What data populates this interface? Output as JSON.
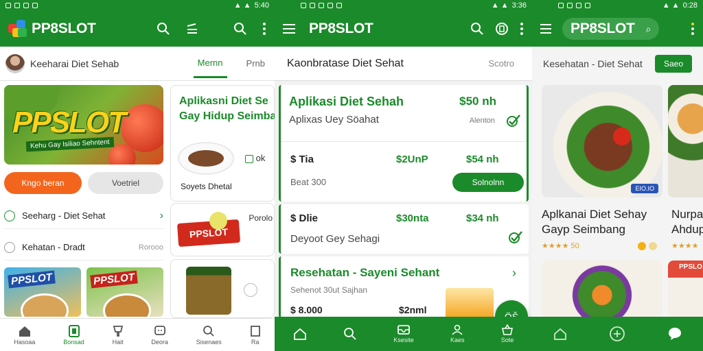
{
  "colors": {
    "brand_green": "#1b8a2a",
    "accent_orange": "#f3651d",
    "badge_blue": "#2a54b5"
  },
  "panel1": {
    "status_time": "5:40",
    "app_title": "PP8SLOT",
    "breadcrumb": "Keeharai Diet Sehab",
    "tabs": [
      "Mernn",
      "Prnb"
    ],
    "hero_brand": "PPSLOT",
    "hero_banner": "Kehu Gay Isiliao Sehntent",
    "btn_primary": "Kngo beran",
    "btn_secondary": "Voetriel",
    "list": [
      {
        "label": "Seeharg - Diet Sehat"
      },
      {
        "label": "Kehatan - Dradt",
        "meta": "Rorooo"
      }
    ],
    "mini_labels": [
      "PPSLOT",
      "PPSLOT"
    ],
    "card": {
      "title_line1": "Aplikasni Diet Se",
      "title_line2": "Gay Hidup Seimba",
      "side": "ok",
      "caption": "Soyets Dhetal"
    },
    "card2_badge": "PPSLOT",
    "card2_side": "Porolo",
    "bottom_nav": [
      "Hasoaa",
      "Bonsad",
      "Hait",
      "Deora",
      "Sisenaes",
      "Ra"
    ]
  },
  "panel2": {
    "status_time": "3:36",
    "app_title": "PP8SLOT",
    "header_title": "Kaonbratase Diet Sehat",
    "header_extra": "Scotro",
    "card1": {
      "title": "Aplikasi Diet Sehah",
      "subtitle": "Aplixas Uey Söahat",
      "price": "$50 nh",
      "meta": "Alenton"
    },
    "row2": {
      "a": "$ Tia",
      "b": "$2UnP",
      "c": "$54 nh",
      "note": "Beat 300",
      "button": "Solnolnn"
    },
    "row3": {
      "a": "$ Dlie",
      "b": "$30nta",
      "c": "$34 nh",
      "note": "Deyoot Gey Sehagi"
    },
    "card3": {
      "title": "Resehatan - Sayeni Sehant",
      "subtitle": "Sehenot 30ut Sajhan",
      "price_left": "$ 8.000",
      "price_right": "$2nml"
    },
    "fab": "ÖŠ",
    "bottom_nav": [
      "Home",
      "Search",
      "Ksesite",
      "Kaes",
      "Sote"
    ]
  },
  "panel3": {
    "status_time": "0:28",
    "app_title": "PP8SLOT",
    "header_title": "Kesehatan - Diet Sehat",
    "save_button": "Saeo",
    "card1": {
      "title_line1": "Aplkanai Diet Sehay",
      "title_line2": "Gayp Seimbang",
      "rating": "★★★★ 50",
      "badge": "EIO.IO"
    },
    "card2": {
      "title_line1": "Nurpa",
      "title_line2": "Ahdup",
      "rating": "★★★★"
    },
    "mini_badge": "PPSLO"
  }
}
